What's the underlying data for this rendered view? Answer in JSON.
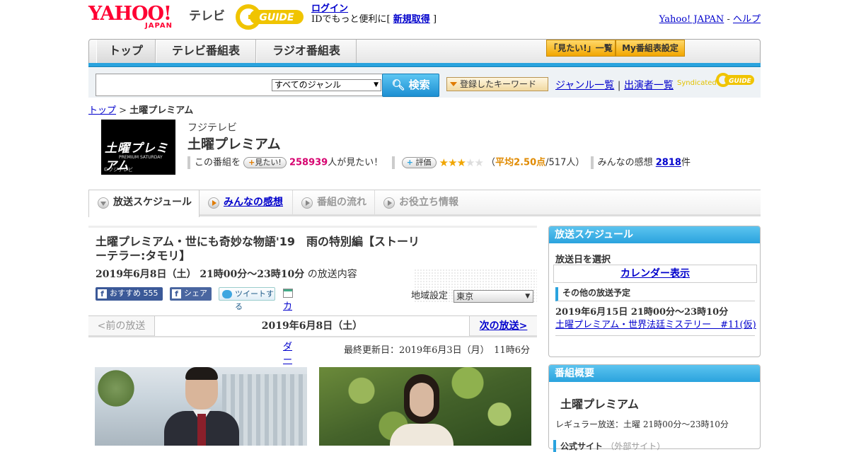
{
  "header": {
    "yahoo_logo": "YAHOO!",
    "yahoo_japan": "JAPAN",
    "tv_label": "テレビ",
    "gguide_logo": "GUIDE",
    "login_link": "ログイン",
    "login_text_prefix": "IDでもっと便利に[",
    "signup_link": "新規取得",
    "login_text_suffix": "]",
    "yahoo_japan_link": "Yahoo! JAPAN",
    "sep": "-",
    "help_link": "ヘルプ"
  },
  "nav": {
    "tabs": [
      {
        "label": "トップ"
      },
      {
        "label": "テレビ番組表"
      },
      {
        "label": "ラジオ番組表"
      }
    ],
    "mitai_list": "「見たい!」一覧",
    "my_schedule": "My番組表設定"
  },
  "search": {
    "query": "",
    "genre": "すべてのジャンル",
    "button": "検索",
    "keyword_button": "登録したキーワード",
    "genre_list": "ジャンル一覧",
    "divider": "|",
    "cast_list": "出演者一覧",
    "syndicated": "Syndicated",
    "syndicated_logo": "GUIDE"
  },
  "breadcrumb": {
    "home": "トップ",
    "sep": ">",
    "current": "土曜プレミアム"
  },
  "program": {
    "thumb_title": "土曜プレミアム",
    "thumb_sub": "PREMIUM SATURDAY",
    "thumb_copy": "©フジテレビ",
    "channel": "フジテレビ",
    "title": "土曜プレミアム",
    "this_program": "この番組を",
    "mitai_button": "見たい!",
    "mitai_count": "258939",
    "mitai_suffix": "人が見たい！",
    "rate_button": "評価",
    "rating_value": 2.5,
    "rating_prefix": "（",
    "rating_avg_label": "平均2.50点",
    "rating_count": "/517人）",
    "comments_label": "みんなの感想",
    "comments_count": "2818",
    "comments_suffix": "件"
  },
  "tabs": [
    {
      "label": "放送スケジュール"
    },
    {
      "label": "みんなの感想"
    },
    {
      "label": "番組の流れ"
    },
    {
      "label": "お役立ち情報"
    }
  ],
  "episode": {
    "title": "土曜プレミアム・世にも奇妙な物語'19　雨の特別編【ストーリーテラー:タモリ】",
    "datetime": "2019年6月8日（土）  21時00分～23時10分",
    "datetime_suffix": "の放送内容",
    "fb_recommend": "おすすめ 555",
    "fb_share": "シェア",
    "tweet": "ツイートする",
    "calendar_register": "カレンダーに登録",
    "region_label": "地域設定",
    "region_value": "東京"
  },
  "pager": {
    "prev": "<前の放送",
    "current": "2019年6月8日（土）",
    "next": "次の放送>"
  },
  "updated": "最終更新日：2019年6月3日（月）　11時6分",
  "sidebar": {
    "schedule_title": "放送スケジュール",
    "select_date": "放送日を選択",
    "calendar_link": "カレンダー表示",
    "other_schedule": "その他の放送予定",
    "other_date": "2019年6月15日  21時00分～23時10分",
    "other_link": "土曜プレミアム・世界法廷ミステリー　#11(仮)",
    "overview_title": "番組概要",
    "overview_name": "土曜プレミアム",
    "regular": "レギュラー放送：土曜 21時00分～23時10分",
    "official_site": "公式サイト",
    "official_site_note": "（外部サイト）"
  },
  "colors": {
    "accent_blue": "#2aa3de",
    "link": "#0000cc",
    "pink": "#d6006f",
    "orange": "#e08a00"
  }
}
